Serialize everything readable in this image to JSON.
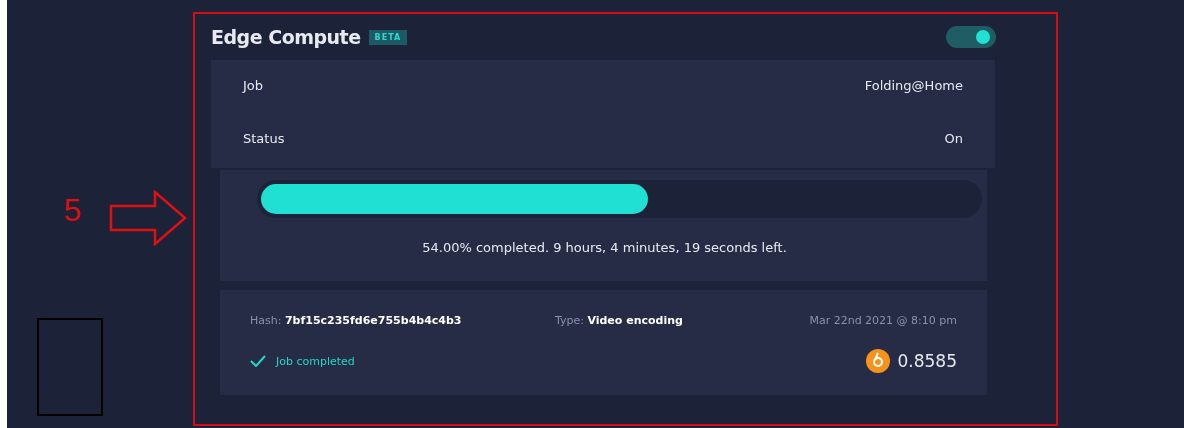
{
  "annotation": {
    "number": "5"
  },
  "panel": {
    "title": "Edge Compute",
    "badge": "BETA",
    "enabled": true,
    "details": [
      {
        "label": "Job",
        "value": "Folding@Home"
      },
      {
        "label": "Status",
        "value": "On"
      }
    ],
    "progress": {
      "level": 0.54,
      "caption": "54.00% completed. 9 hours, 4 minutes, 19 seconds left."
    },
    "job": {
      "hash_label": "Hash:",
      "hash": "7bf15c235fd6e755b4b4c4b3",
      "type_label": "Type:",
      "type": "Video encoding",
      "date": "Mar 22nd 2021 @ 8:10 pm",
      "status": "Job completed",
      "completed": true,
      "amount": "0.8585"
    }
  }
}
